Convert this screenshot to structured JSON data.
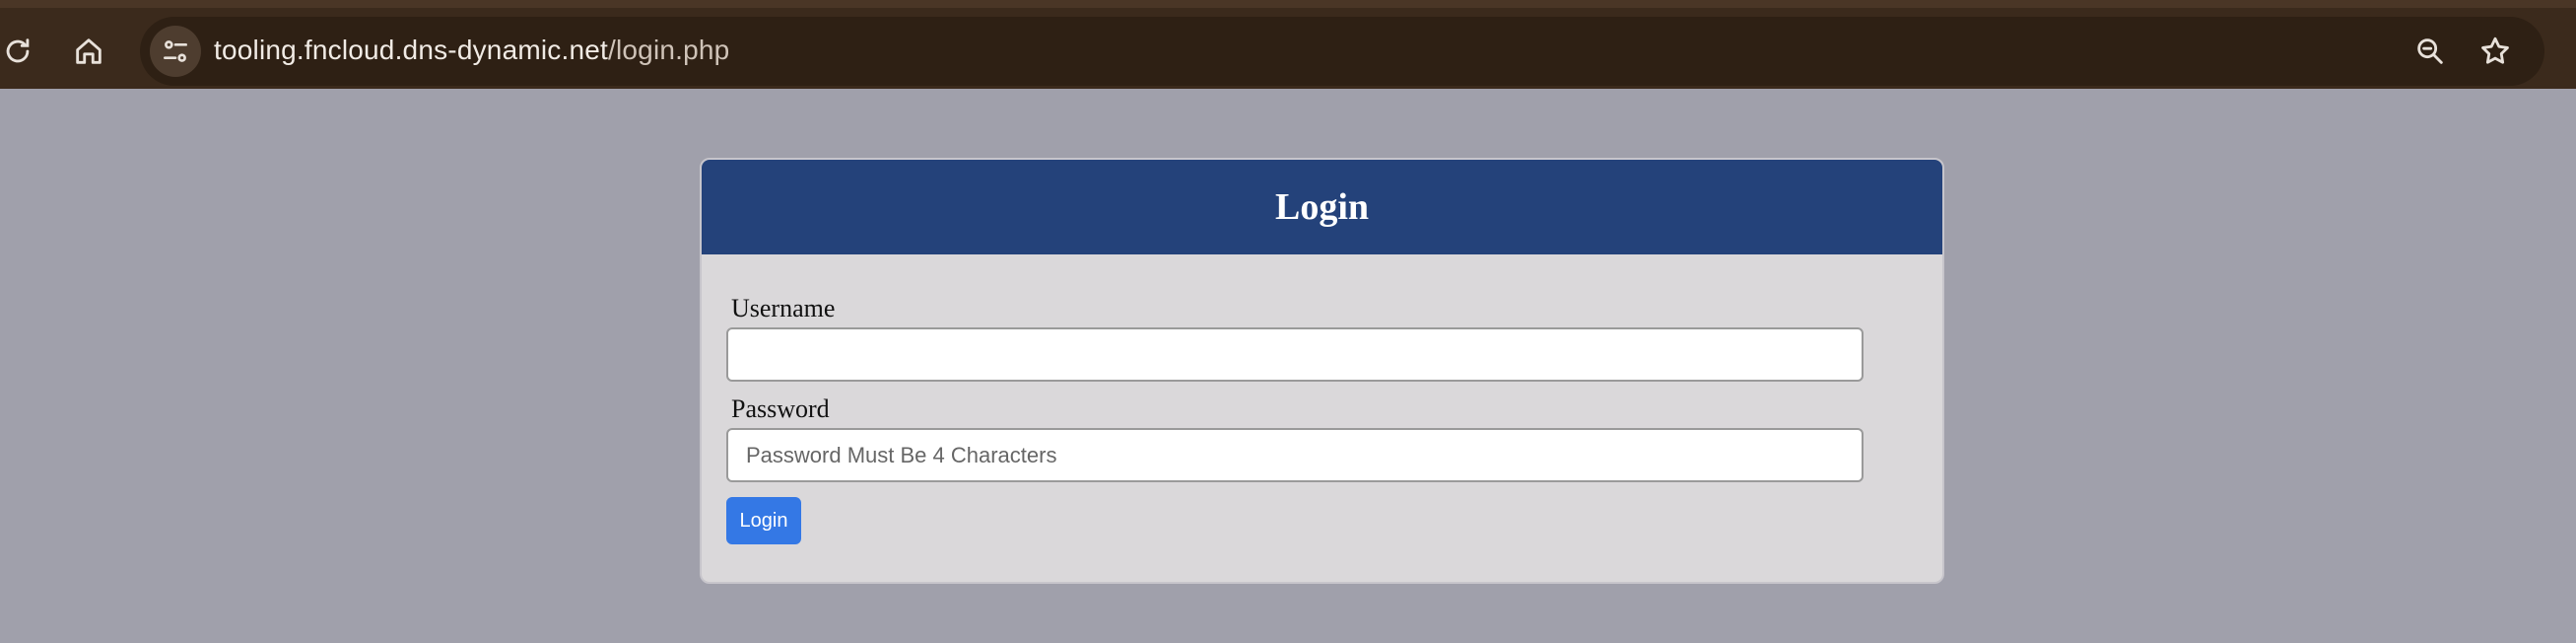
{
  "browser": {
    "url_domain": "tooling.fncloud.dns-dynamic.net",
    "url_path": "/login.php",
    "icons": {
      "reload": "reload-icon",
      "home": "home-icon",
      "site_info": "site-settings-icon",
      "zoom": "zoom-out-icon",
      "bookmark": "star-icon"
    }
  },
  "login_form": {
    "title": "Login",
    "username_label": "Username",
    "username_value": "",
    "password_label": "Password",
    "password_placeholder": "Password Must Be 4 Characters",
    "submit_label": "Login"
  },
  "colors": {
    "page_background": "#a0a0ab",
    "header_background": "#24427a",
    "card_background": "#dad8da",
    "button_background": "#3478e5",
    "browser_chrome": "#3b2a1c"
  }
}
